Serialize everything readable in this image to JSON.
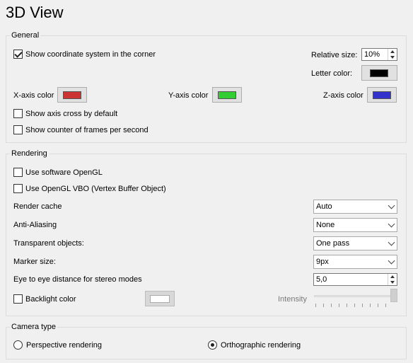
{
  "page": {
    "title": "3D View"
  },
  "general": {
    "legend": "General",
    "show_coordinate_system": {
      "label": "Show coordinate system in the corner",
      "checked": true
    },
    "relative_size": {
      "label": "Relative size:",
      "value": "10%"
    },
    "letter_color": {
      "label": "Letter color:",
      "color": "#000000"
    },
    "x_axis": {
      "label": "X-axis color",
      "color": "#cc3333"
    },
    "y_axis": {
      "label": "Y-axis color",
      "color": "#33cc33"
    },
    "z_axis": {
      "label": "Z-axis color",
      "color": "#3333cc"
    },
    "show_axis_cross": {
      "label": "Show axis cross by default",
      "checked": false
    },
    "show_fps": {
      "label": "Show counter of frames per second",
      "checked": false
    }
  },
  "rendering": {
    "legend": "Rendering",
    "software_opengl": {
      "label": "Use software OpenGL",
      "checked": false
    },
    "opengl_vbo": {
      "label": "Use OpenGL VBO (Vertex Buffer Object)",
      "checked": false
    },
    "render_cache": {
      "label": "Render cache",
      "value": "Auto"
    },
    "anti_aliasing": {
      "label": "Anti-Aliasing",
      "value": "None"
    },
    "transparent_objects": {
      "label": "Transparent objects:",
      "value": "One pass"
    },
    "marker_size": {
      "label": "Marker size:",
      "value": "9px"
    },
    "eye_distance": {
      "label": "Eye to eye distance for stereo modes",
      "value": "5,0"
    },
    "backlight": {
      "label": "Backlight color",
      "checked": false,
      "color": "#ffffff"
    },
    "intensity": {
      "label": "Intensity",
      "level_percent": 100
    }
  },
  "camera": {
    "legend": "Camera type",
    "perspective": {
      "label": "Perspective rendering",
      "selected": false
    },
    "orthographic": {
      "label": "Orthographic rendering",
      "selected": true
    }
  }
}
